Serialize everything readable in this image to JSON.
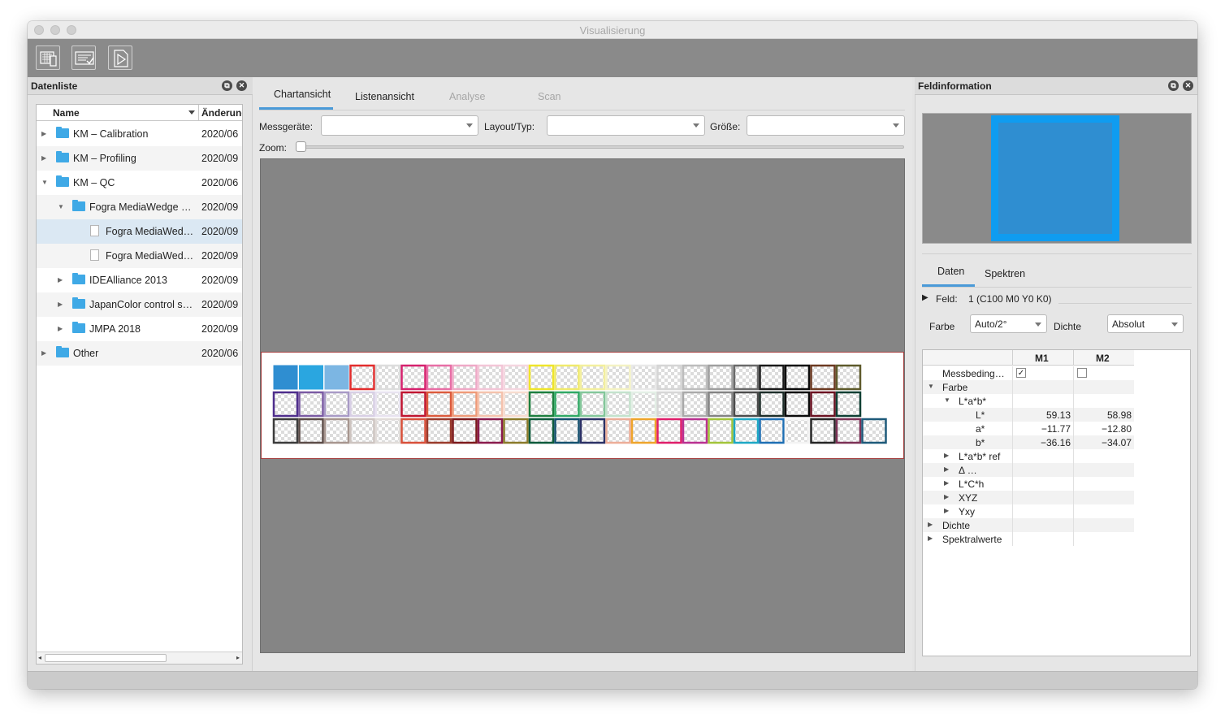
{
  "window": {
    "title": "Visualisierung"
  },
  "toolbar": {
    "buttons": [
      "chart-view-icon",
      "list-check-icon",
      "document-play-icon"
    ]
  },
  "left_panel": {
    "title": "Datenliste",
    "columns": {
      "name": "Name",
      "date": "Änderung"
    },
    "rows": [
      {
        "label": "KM – Calibration",
        "date": "2020/06",
        "indent": 0,
        "expanded": false,
        "type": "folder"
      },
      {
        "label": "KM – Profiling",
        "date": "2020/09",
        "indent": 0,
        "expanded": false,
        "type": "folder"
      },
      {
        "label": "KM – QC",
        "date": "2020/06",
        "indent": 0,
        "expanded": true,
        "type": "folder"
      },
      {
        "label": "Fogra MediaWedge …",
        "date": "2020/09",
        "indent": 1,
        "expanded": true,
        "type": "folder"
      },
      {
        "label": "Fogra MediaWed…",
        "date": "2020/09",
        "indent": 2,
        "type": "file",
        "selected": true
      },
      {
        "label": "Fogra MediaWed…",
        "date": "2020/09",
        "indent": 2,
        "type": "file"
      },
      {
        "label": "IDEAlliance 2013",
        "date": "2020/09",
        "indent": 1,
        "expanded": false,
        "type": "folder"
      },
      {
        "label": "JapanColor control s…",
        "date": "2020/09",
        "indent": 1,
        "expanded": false,
        "type": "folder"
      },
      {
        "label": "JMPA 2018",
        "date": "2020/09",
        "indent": 1,
        "expanded": false,
        "type": "folder"
      },
      {
        "label": "Other",
        "date": "2020/06",
        "indent": 0,
        "expanded": false,
        "type": "folder"
      }
    ]
  },
  "center": {
    "tabs": [
      "Chartansicht",
      "Listenansicht",
      "Analyse",
      "Scan"
    ],
    "active_tab": "Chartansicht",
    "messgeraete_label": "Messgeräte:",
    "layout_label": "Layout/Typ:",
    "groesse_label": "Größe:",
    "zoom_label": "Zoom:",
    "zoom_level": 0,
    "patch_rows": [
      [
        "#2f8ed1",
        "#2aa6e0",
        "#7cb6e3",
        "#e32d2d",
        "#dddddd",
        "#d6226e",
        "#e86fa6",
        "#efa9c7",
        "#f3c6d7",
        "#f5d6e0",
        "#efe52a",
        "#f0ea6c",
        "#f3ef9e",
        "#f4f2c3",
        "#e9e9e9",
        "#d5d5d5",
        "#bdbdbd",
        "#9f9f9f",
        "#6a6a6a",
        "#1b1b1b",
        "#0d0d0d",
        "#6c3a22",
        "#5e5a2b"
      ],
      [
        "#4e2d8c",
        "#7a5aa3",
        "#a89ac6",
        "#d8cfe5",
        "#e8e3f0",
        "#c01530",
        "#dc5a3c",
        "#ef9a78",
        "#f5c2ad",
        "#f8dccf",
        "#1c7f3e",
        "#2fa864",
        "#83c79a",
        "#c3e2cc",
        "#e3efe6",
        "#d6d6d6",
        "#a9a9a9",
        "#838383",
        "#4b4b4b",
        "#1e2e2a",
        "#0b0b0b",
        "#6b1222",
        "#0f3f33"
      ],
      [
        "#3b3b3b",
        "#5c4c48",
        "#a7968f",
        "#cdc4c0",
        "#e1dcd9",
        "#d8503a",
        "#9a3b2c",
        "#7d1a1c",
        "#8a1b4d",
        "#8a7a2a",
        "#0d5a3b",
        "#14506e",
        "#2b3166",
        "#ecad98",
        "#eea52b",
        "#df1e6a",
        "#b93191",
        "#a2c43a",
        "#1ea8c5",
        "#1e6fb4",
        "#f3f3f3",
        "#262626",
        "#7c3156",
        "#1e5a7a"
      ]
    ]
  },
  "right_panel": {
    "title": "Feldinformation",
    "preview_color": "#2f8ed1",
    "preview_border": "#0f9cf0",
    "tabs": [
      "Daten",
      "Spektren"
    ],
    "feld_label": "Feld:",
    "feld_value": "1 (C100 M0 Y0 K0)",
    "farbe_label": "Farbe",
    "farbe_value": "Auto/2°",
    "dichte_label": "Dichte",
    "dichte_value": "Absolut",
    "table_headers": [
      "M1",
      "M2"
    ],
    "table_rows": [
      {
        "label": "Messbeding…",
        "indent": 0,
        "tri": "",
        "m1": "check",
        "m2": "box"
      },
      {
        "label": "Farbe",
        "indent": 0,
        "tri": "down",
        "m1": "",
        "m2": ""
      },
      {
        "label": "L*a*b*",
        "indent": 1,
        "tri": "down",
        "m1": "",
        "m2": ""
      },
      {
        "label": "L*",
        "indent": 2,
        "tri": "",
        "m1": "59.13",
        "m2": "58.98"
      },
      {
        "label": "a*",
        "indent": 2,
        "tri": "",
        "m1": "−11.77",
        "m2": "−12.80"
      },
      {
        "label": "b*",
        "indent": 2,
        "tri": "",
        "m1": "−36.16",
        "m2": "−34.07"
      },
      {
        "label": "L*a*b* ref",
        "indent": 1,
        "tri": "right",
        "m1": "",
        "m2": ""
      },
      {
        "label": "Δ …",
        "indent": 1,
        "tri": "right",
        "m1": "",
        "m2": ""
      },
      {
        "label": "L*C*h",
        "indent": 1,
        "tri": "right",
        "m1": "",
        "m2": ""
      },
      {
        "label": "XYZ",
        "indent": 1,
        "tri": "right",
        "m1": "",
        "m2": ""
      },
      {
        "label": "Yxy",
        "indent": 1,
        "tri": "right",
        "m1": "",
        "m2": ""
      },
      {
        "label": "Dichte",
        "indent": 0,
        "tri": "right",
        "m1": "",
        "m2": ""
      },
      {
        "label": "Spektralwerte",
        "indent": 0,
        "tri": "right",
        "m1": "",
        "m2": ""
      }
    ]
  }
}
